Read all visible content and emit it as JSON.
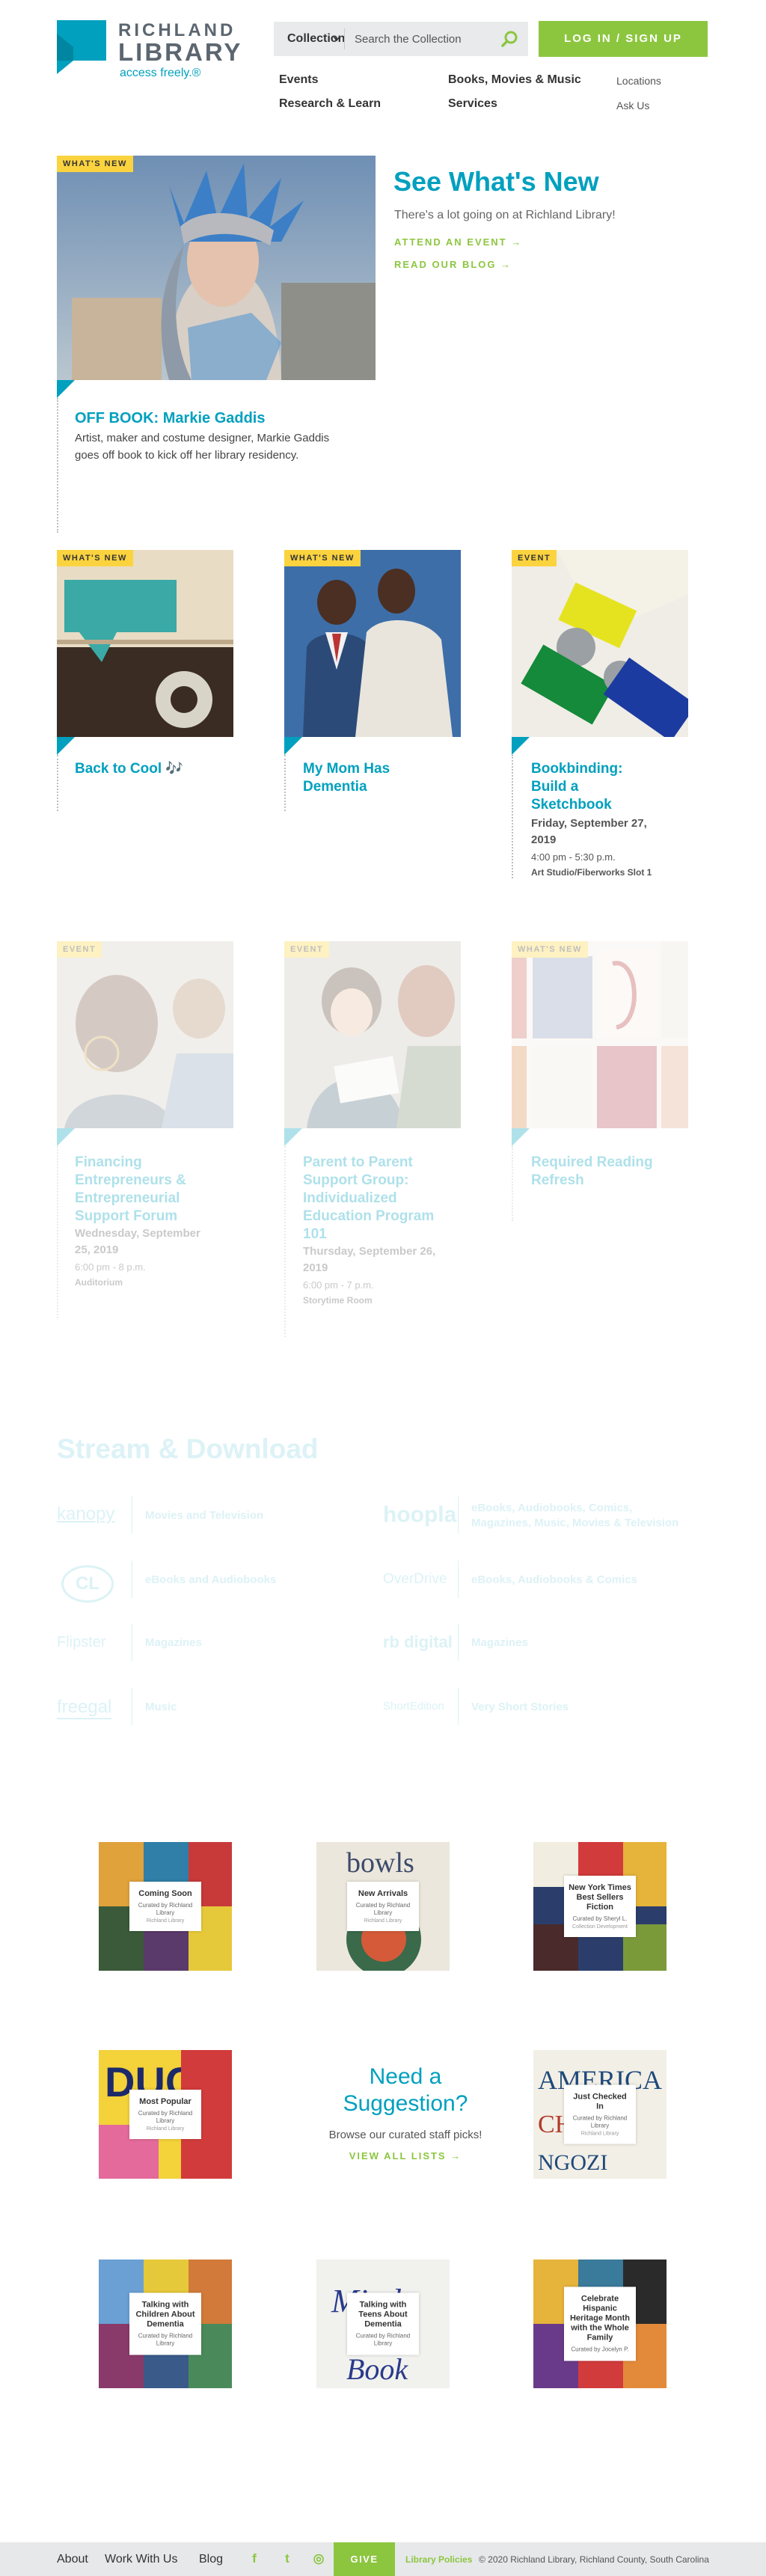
{
  "brand": {
    "line1": "RICHLAND",
    "line2": "LIBRARY",
    "tagline": "access freely.®",
    "color": "#00a0be",
    "accent": "#8cc63f"
  },
  "search": {
    "scope": "Collection",
    "placeholder": "Search the Collection",
    "icon": "search-icon"
  },
  "login": {
    "label": "LOG IN / SIGN UP"
  },
  "nav": {
    "primary": [
      "Events",
      "Books, Movies & Music",
      "Research & Learn",
      "Services"
    ],
    "secondary": [
      "Locations",
      "Ask Us"
    ]
  },
  "whats_new": {
    "title": "See What's New",
    "subtitle": "There's a lot going on at Richland Library!",
    "links": [
      "ATTEND AN EVENT →",
      "READ OUR BLOG →"
    ],
    "feature": {
      "tag": "WHAT'S NEW",
      "title": "OFF BOOK: Markie Gaddis",
      "description": "Artist, maker and costume designer, Markie Gaddis goes off book to kick off her library residency."
    }
  },
  "cards": [
    {
      "tag": "WHAT'S NEW",
      "title": "Back to Cool 🎶"
    },
    {
      "tag": "WHAT'S NEW",
      "title": "My Mom Has Dementia"
    },
    {
      "tag": "EVENT",
      "title": "Bookbinding: Build a Sketchbook",
      "date": "Friday, September 27, 2019",
      "time": "4:00 pm - 5:30 p.m.",
      "location": "Art Studio/Fiberworks Slot 1"
    },
    {
      "tag": "EVENT",
      "title": "Financing Entrepreneurs & Entrepreneurial Support Forum",
      "date": "Wednesday, September 25, 2019",
      "time": "6:00 pm - 8 p.m.",
      "location": "Auditorium"
    },
    {
      "tag": "EVENT",
      "title": "Parent to Parent Support Group: Individualized Education Program 101",
      "date": "Thursday, September 26, 2019",
      "time": "6:00 pm - 7 p.m.",
      "location": "Storytime Room"
    },
    {
      "tag": "WHAT'S NEW",
      "title": "Required Reading Refresh"
    }
  ],
  "stream": {
    "title": "Stream & Download",
    "services": [
      {
        "logo": "kanopy",
        "desc": "Movies and Television"
      },
      {
        "logo": "hoopla",
        "desc": "eBooks, Audiobooks, Comics, Magazines, Music, Movies & Television"
      },
      {
        "logo": "CL",
        "desc": "eBooks and Audiobooks"
      },
      {
        "logo": "OverDrive",
        "desc": "eBooks, Audiobooks & Comics"
      },
      {
        "logo": "Flipster",
        "desc": "Magazines"
      },
      {
        "logo": "rb digital",
        "desc": "Magazines"
      },
      {
        "logo": "freegal",
        "desc": "Music"
      },
      {
        "logo": "ShortEdition",
        "desc": "Very Short Stories"
      }
    ]
  },
  "lists": [
    {
      "name": "Coming Soon",
      "by": "Curated by Richland Library",
      "sub": "Richland Library"
    },
    {
      "name": "New Arrivals",
      "by": "Curated by Richland Library",
      "sub": "Richland Library"
    },
    {
      "name": "New York Times Best Sellers Fiction",
      "by": "Curated by Sheryl L.",
      "sub": "Collection Development"
    },
    {
      "name": "Most Popular",
      "by": "Curated by Richland Library",
      "sub": "Richland Library"
    },
    {
      "name": "Just Checked In",
      "by": "Curated by Richland Library",
      "sub": "Richland Library"
    },
    {
      "name": "Talking with Children About Dementia",
      "by": "Curated by Richland Library",
      "sub": ""
    },
    {
      "name": "Talking with Teens About Dementia",
      "by": "Curated by Richland Library",
      "sub": ""
    },
    {
      "name": "Celebrate Hispanic Heritage Month with the Whole Family",
      "by": "Curated by Jocelyn P.",
      "sub": ""
    }
  ],
  "suggestion": {
    "title": "Need a Suggestion?",
    "subtitle": "Browse our curated staff picks!",
    "link": "VIEW ALL LISTS →"
  },
  "footer": {
    "links": [
      "About",
      "Work With Us",
      "Blog"
    ],
    "social": [
      "f",
      "t",
      "◎"
    ],
    "give": "GIVE",
    "policies": "Library Policies",
    "copyright": "© 2020 Richland Library, Richland County, South Carolina"
  }
}
